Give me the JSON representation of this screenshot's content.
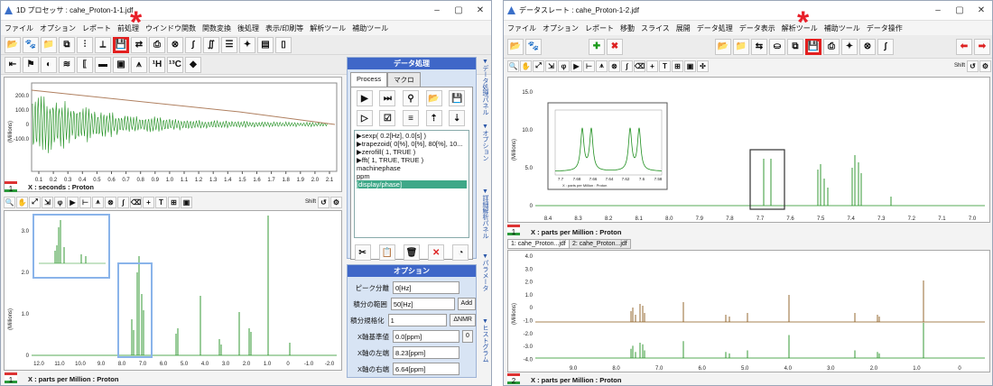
{
  "left": {
    "title": "1D プロセッサ : cahe_Proton-1-1.jdf",
    "menu": [
      "ファイル",
      "オプション",
      "レポート",
      "前処理",
      "ウインドウ関数",
      "関数変換",
      "後処理",
      "表示/印刷等",
      "解析ツール",
      "補助ツール"
    ],
    "fid_axis": {
      "ticks": [
        "0.1",
        "0.2",
        "0.3",
        "0.4",
        "0.5",
        "0.6",
        "0.7",
        "0.8",
        "0.9",
        "1.0",
        "1.1",
        "1.2",
        "1.3",
        "1.4",
        "1.5",
        "1.6",
        "1.7",
        "1.8",
        "1.9",
        "2.0",
        "2.1"
      ],
      "y_ticks": [
        "200.0",
        "100.0",
        "0",
        "-100.0"
      ],
      "unit": "(Millions)"
    },
    "fid_status": "X : seconds : Proton",
    "fid_panel_num": "1",
    "spec_axis": {
      "ticks": [
        "12.0",
        "11.0",
        "10.0",
        "9.0",
        "8.0",
        "7.0",
        "6.0",
        "5.0",
        "4.0",
        "3.0",
        "2.0",
        "1.0",
        "0",
        "-1.0",
        "-2.0"
      ],
      "y_ticks": [
        "3.0",
        "2.0",
        "1.0",
        "0"
      ],
      "unit": "(Millions)"
    },
    "spec_status": "X : parts per Million : Proton",
    "spec_panel_num": "1",
    "shift_label": "Shift",
    "data_panel": {
      "header": "データ処理",
      "tab_process": "Process",
      "tab_macro": "マクロ",
      "process_list": [
        "▶sexp( 0.2[Hz], 0.0[s] )",
        "▶trapezoid( 0[%], 0[%], 80[%], 10...",
        "▶zerofill( 1, TRUE )",
        "▶fft( 1, TRUE, TRUE )",
        "machinephase",
        "ppm",
        "[display/phase]"
      ]
    },
    "option_panel": {
      "header": "オプション",
      "rows": [
        {
          "label": "ピーク分離",
          "value": "0[Hz]",
          "button": ""
        },
        {
          "label": "積分の範囲",
          "value": "50[Hz]",
          "button": "Add"
        },
        {
          "label": "積分規格化",
          "value": "1",
          "button": "ΔNMR"
        },
        {
          "label": "X軸基準値",
          "value": "0.0[ppm]",
          "button": "0"
        },
        {
          "label": "X軸の左端",
          "value": "8.23[ppm]",
          "button": ""
        },
        {
          "label": "X軸の右端",
          "value": "6.64[ppm]",
          "button": ""
        }
      ]
    },
    "side_tabs": [
      "データ処理パネル",
      "オプション",
      "詳細解析パネル",
      "パラメータ",
      "ヒストグラム"
    ]
  },
  "right": {
    "title": "データスレート : cahe_Proton-1-2.jdf",
    "menu": [
      "ファイル",
      "オプション",
      "レポート",
      "移動",
      "スライス",
      "展開",
      "データ処理",
      "データ表示",
      "解析ツール",
      "補助ツール",
      "データ操作"
    ],
    "top_axis": {
      "ticks": [
        "8.4",
        "8.3",
        "8.2",
        "8.1",
        "8.0",
        "7.9",
        "7.8",
        "7.7",
        "7.6",
        "7.5",
        "7.4",
        "7.3",
        "7.2",
        "7.1",
        "7.0"
      ],
      "y_ticks": [
        "15.0",
        "10.0",
        "5.0",
        "0"
      ],
      "unit": "(Millions)"
    },
    "top_status": "X : parts per Million : Proton",
    "top_panel_num": "1",
    "inset_axis": [
      "7.7",
      "7.68",
      "7.66",
      "7.64",
      "7.62",
      "7.6",
      "7.58"
    ],
    "inset_caption": "X : parts per Million : Proton",
    "doc_tabs": [
      "1: cahe_Proton...jdf",
      "2: cahe_Proton...jdf"
    ],
    "bottom_axis": {
      "ticks": [
        "9.0",
        "8.0",
        "7.0",
        "6.0",
        "5.0",
        "4.0",
        "3.0",
        "2.0",
        "1.0",
        "0"
      ],
      "y_ticks": [
        "4.0",
        "3.0",
        "2.0",
        "1.0",
        "0",
        "-1.0",
        "-2.0",
        "-3.0",
        "-4.0"
      ],
      "unit": "(Millions)"
    },
    "bottom_status": "X : parts per Million : Proton",
    "bottom_panel_num": "2",
    "shift_label": "Shift"
  },
  "marker": "*",
  "colors": {
    "accent_red": "#e32020",
    "spectrum_green": "#1f8f1f",
    "spectrum_brown": "#8a5a1a",
    "fid_trace": "#b08060",
    "panel_blue": "#3f67c8"
  }
}
